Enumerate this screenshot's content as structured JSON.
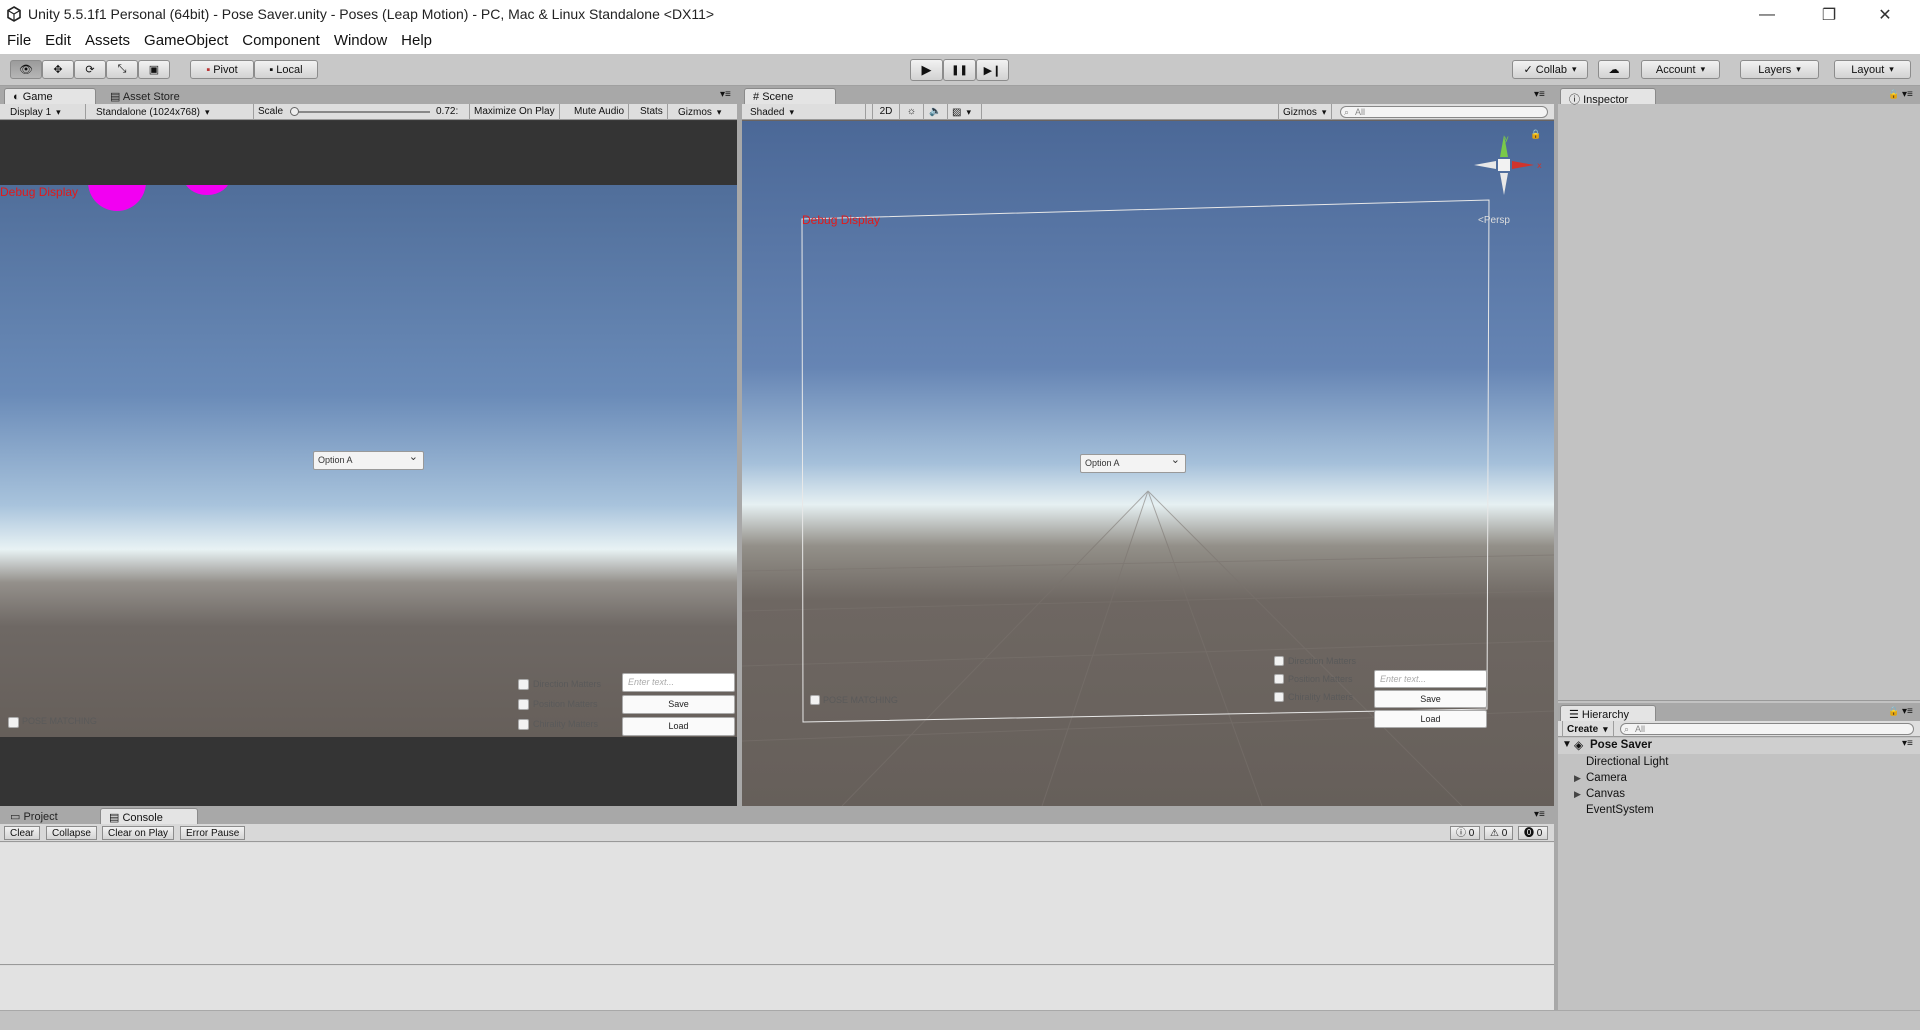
{
  "window": {
    "title": "Unity 5.5.1f1 Personal (64bit) - Pose Saver.unity - Poses (Leap Motion) - PC, Mac & Linux Standalone <DX11>",
    "minimize": "—",
    "maximize": "❐",
    "close": "✕"
  },
  "menu": [
    "File",
    "Edit",
    "Assets",
    "GameObject",
    "Component",
    "Window",
    "Help"
  ],
  "toolbar": {
    "pivot": "Pivot",
    "local": "Local",
    "play": "▶",
    "pause": "❚❚",
    "step": "▶❙",
    "collab": "Collab",
    "account": "Account",
    "layers": "Layers",
    "layout": "Layout"
  },
  "game": {
    "tab": "Game",
    "tab2": "Asset Store",
    "display": "Display 1",
    "resolution": "Standalone (1024x768)",
    "scale_label": "Scale",
    "scale_value": "0.72:",
    "maximize": "Maximize On Play",
    "mute": "Mute Audio",
    "stats": "Stats",
    "gizmos": "Gizmos",
    "debug": "Debug Display",
    "option": "Option A",
    "direction": "Direction Matters",
    "position": "Position Matters",
    "chirality": "Chirality Matters",
    "input_placeholder": "Enter text...",
    "save": "Save",
    "load": "Load",
    "pose_matching": "POSE MATCHING"
  },
  "scene": {
    "tab": "Scene",
    "shading": "Shaded",
    "mode2d": "2D",
    "gizmos": "Gizmos",
    "search": "All",
    "persp": "Persp",
    "debug": "Debug Display",
    "option": "Option A",
    "direction": "Direction Matters",
    "position": "Position Matters",
    "chirality": "Chirality Matters",
    "input_placeholder": "Enter text...",
    "save": "Save",
    "load": "Load",
    "pose_matching": "POSE MATCHING"
  },
  "inspector": {
    "tab": "Inspector"
  },
  "hierarchy": {
    "tab": "Hierarchy",
    "create": "Create",
    "search": "All",
    "scene": "Pose Saver",
    "items": [
      "Directional Light",
      "Camera",
      "Canvas",
      "EventSystem"
    ]
  },
  "console": {
    "tab_project": "Project",
    "tab_console": "Console",
    "clear": "Clear",
    "collapse": "Collapse",
    "clear_on_play": "Clear on Play",
    "error_pause": "Error Pause",
    "info_count": "0",
    "warn_count": "0",
    "error_count": "0"
  }
}
